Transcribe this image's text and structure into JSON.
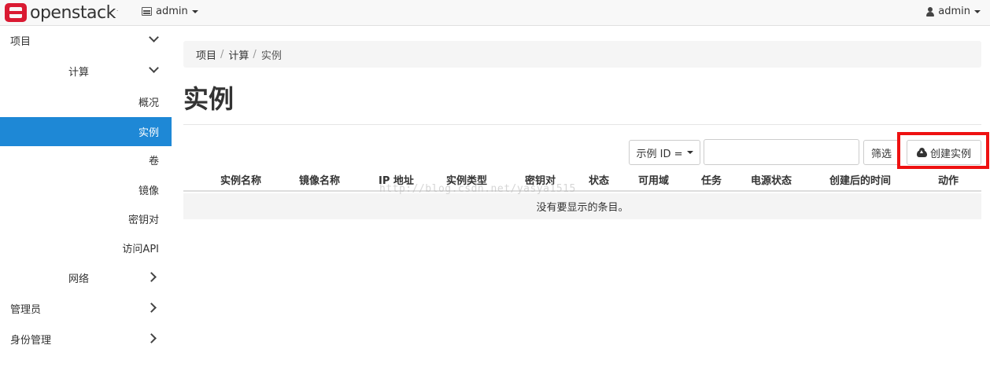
{
  "navbar": {
    "brand": "openstack",
    "brand_mark": ".",
    "project": "admin",
    "user": "admin"
  },
  "sidebar": {
    "project": "项目",
    "compute": "计算",
    "items": [
      "概况",
      "实例",
      "卷",
      "镜像",
      "密钥对",
      "访问API"
    ],
    "active_item": "实例",
    "network": "网络",
    "admin": "管理员",
    "identity": "身份管理"
  },
  "breadcrumb": {
    "items": [
      "项目",
      "计算",
      "实例"
    ],
    "separator": "/"
  },
  "page": {
    "title": "实例"
  },
  "filter": {
    "select_label": "示例 ID =",
    "input_value": "",
    "button": "筛选"
  },
  "actions": {
    "create": "创建实例"
  },
  "table": {
    "columns": [
      "实例名称",
      "镜像名称",
      "IP 地址",
      "实例类型",
      "密钥对",
      "状态",
      "可用域",
      "任务",
      "电源状态",
      "创建后的时间",
      "动作"
    ],
    "empty_message": "没有要显示的条目。"
  },
  "watermark": "http://blog.csdn.net/yasya1515",
  "colors": {
    "accent": "#1e88d6",
    "brand_red": "#da1a32",
    "highlight_red": "#ee1111"
  }
}
